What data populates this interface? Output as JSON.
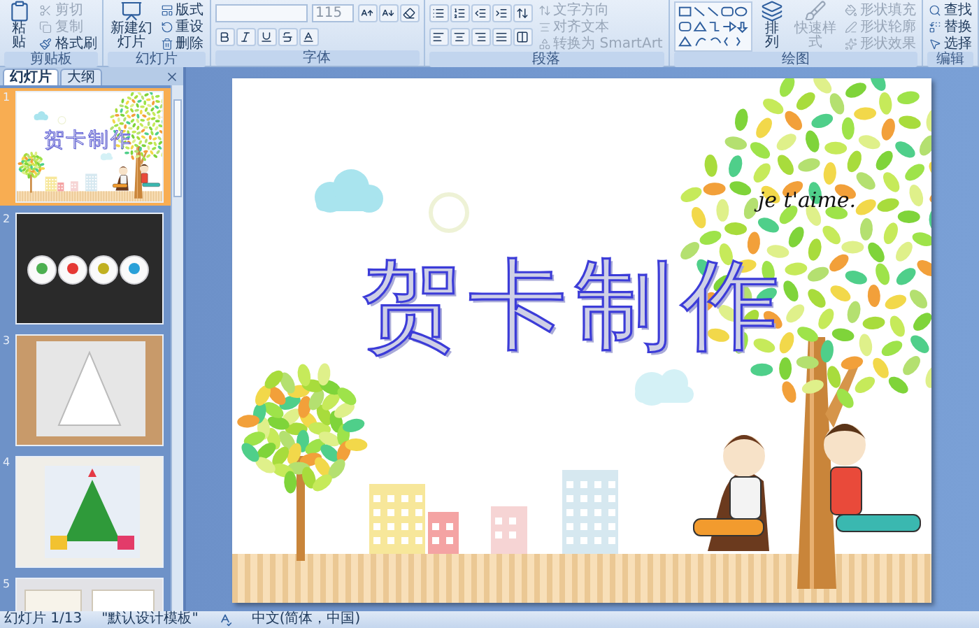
{
  "ribbon": {
    "groups": [
      {
        "kind": "buttons",
        "label": "剪贴板",
        "buttons": [
          {
            "kind": "large",
            "label": "粘贴",
            "disabled": false
          },
          {
            "kind": "small",
            "label": "剪切",
            "disabled": true
          },
          {
            "kind": "small",
            "label": "复制",
            "disabled": true
          },
          {
            "kind": "small",
            "label": "格式刷",
            "disabled": false
          }
        ]
      },
      {
        "kind": "buttons",
        "label": "幻灯片",
        "buttons": [
          {
            "kind": "large",
            "label": "新建幻灯片",
            "disabled": false
          },
          {
            "kind": "small",
            "label": "版式",
            "disabled": false
          },
          {
            "kind": "small",
            "label": "重设",
            "disabled": false
          },
          {
            "kind": "small",
            "label": "删除",
            "disabled": false
          }
        ]
      },
      {
        "kind": "font",
        "label": "字体",
        "font_size": "115"
      },
      {
        "kind": "paragraph",
        "label": "段落",
        "buttons": [
          {
            "kind": "small",
            "label": "文字方向",
            "disabled": true
          },
          {
            "kind": "small",
            "label": "对齐文本",
            "disabled": true
          },
          {
            "kind": "small",
            "label": "转换为 SmartArt",
            "disabled": true
          }
        ]
      },
      {
        "kind": "drawing",
        "label": "绘图",
        "buttons": [
          {
            "kind": "large",
            "label": "排列",
            "disabled": false
          },
          {
            "kind": "large",
            "label": "快速样式",
            "disabled": true
          },
          {
            "kind": "small",
            "label": "形状填充",
            "disabled": true
          },
          {
            "kind": "small",
            "label": "形状轮廓",
            "disabled": true
          },
          {
            "kind": "small",
            "label": "形状效果",
            "disabled": true
          }
        ]
      },
      {
        "kind": "buttons",
        "label": "编辑",
        "buttons": [
          {
            "kind": "small",
            "label": "查找",
            "disabled": false
          },
          {
            "kind": "small",
            "label": "替换",
            "disabled": false
          },
          {
            "kind": "small",
            "label": "选择",
            "disabled": false
          }
        ]
      }
    ]
  },
  "panel": {
    "tabs": [
      {
        "label": "幻灯片",
        "selected": true
      },
      {
        "label": "大纲",
        "selected": false
      }
    ],
    "thumbnails": [
      {
        "number": "1",
        "kind": "title",
        "title": "贺卡制作",
        "selected": true
      },
      {
        "number": "2",
        "kind": "picture",
        "selected": false
      },
      {
        "number": "3",
        "kind": "picture",
        "selected": false
      },
      {
        "number": "4",
        "kind": "picture",
        "selected": false
      },
      {
        "number": "5",
        "kind": "picture",
        "selected": false
      }
    ]
  },
  "slide": {
    "title": "贺卡制作",
    "caption": "je t'aime."
  },
  "status_bar": {
    "slide": "幻灯片 1/13",
    "theme": "\"默认设计模板\"",
    "language": "中文(简体，中国)"
  }
}
